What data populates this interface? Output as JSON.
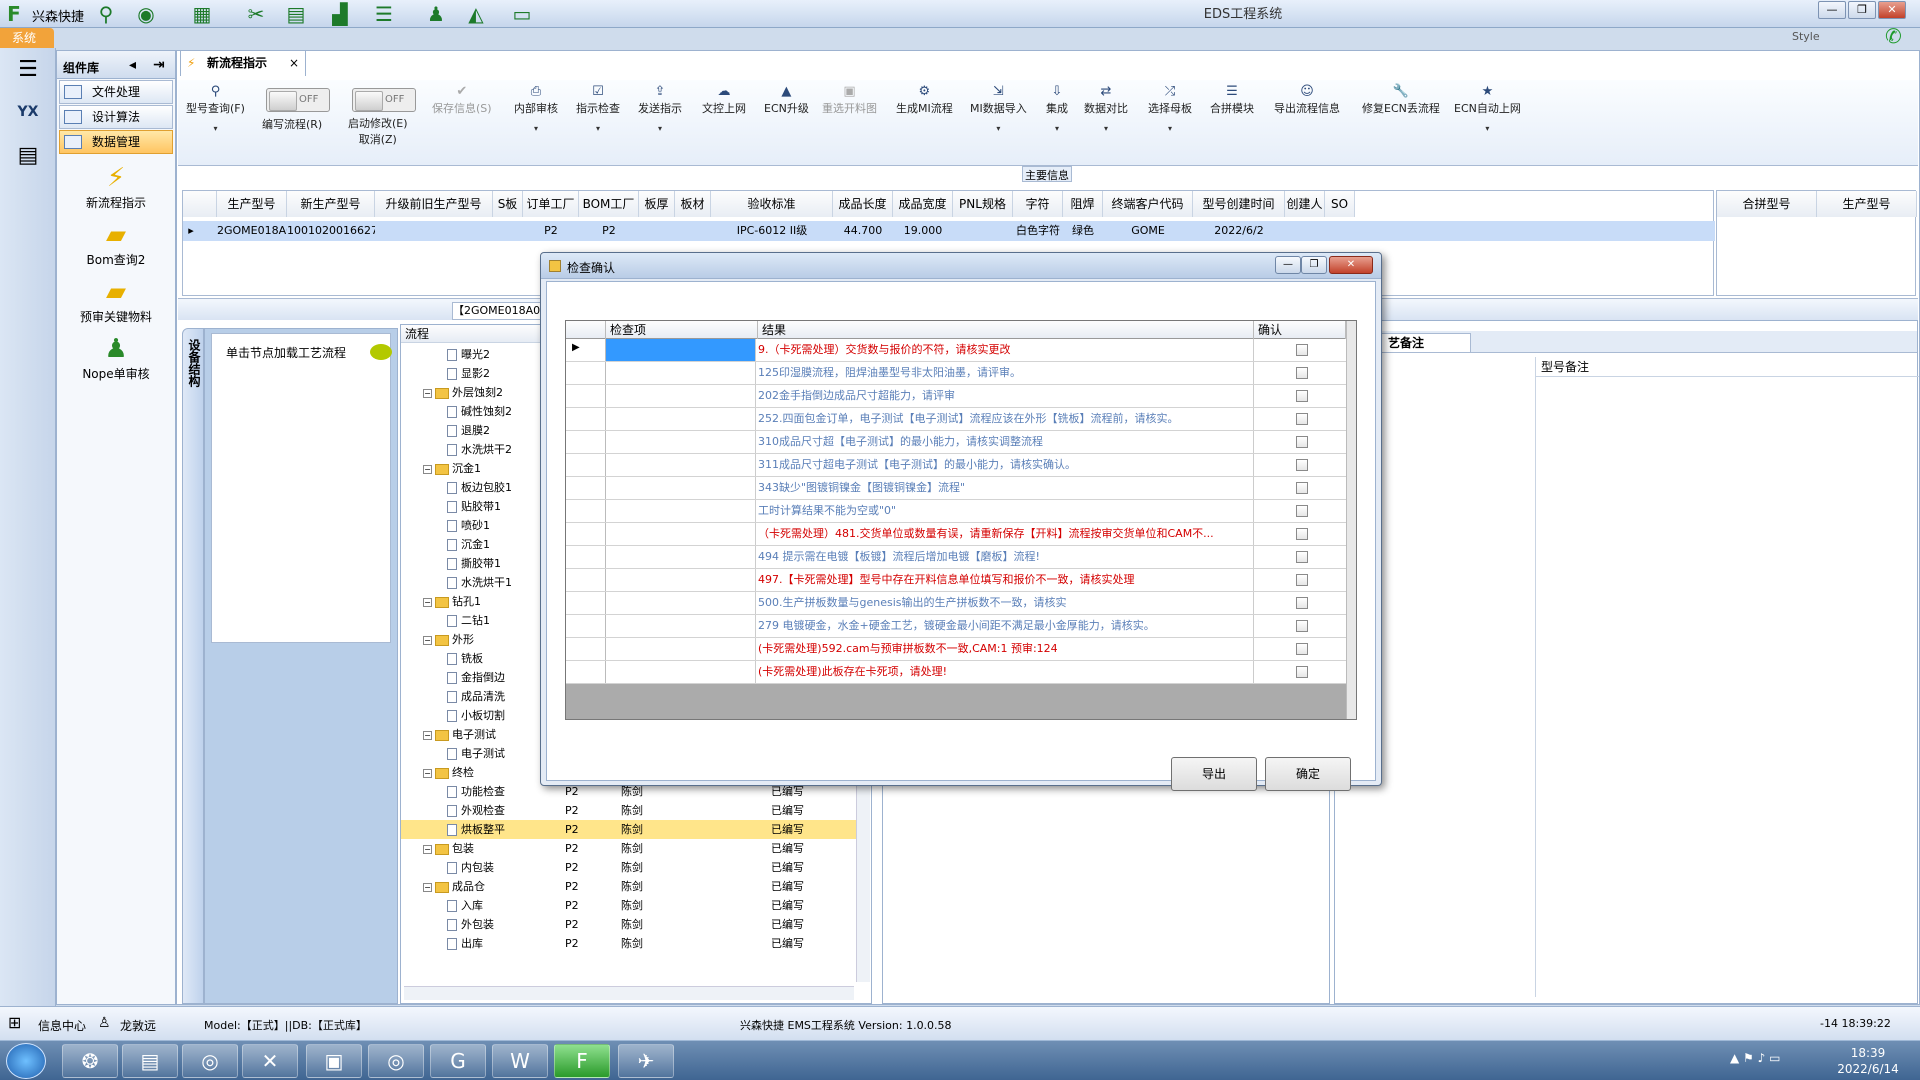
{
  "window": {
    "app_brand": "兴森快捷",
    "title": "EDS工程系统",
    "style_label": "Style",
    "system_tab": "系统"
  },
  "component_panel": {
    "title": "组件库",
    "items": [
      {
        "label": "文件处理",
        "selected": false
      },
      {
        "label": "设计算法",
        "selected": false
      },
      {
        "label": "数据管理",
        "selected": true
      }
    ],
    "big_items": [
      {
        "label": "新流程指示",
        "icon": "lightning-icon"
      },
      {
        "label": "Bom查询2",
        "icon": "folder-icon"
      },
      {
        "label": "预审关键物料",
        "icon": "folder-icon"
      },
      {
        "label": "Nope单审核",
        "icon": "user-icon"
      }
    ]
  },
  "doc_tab": {
    "label": "新流程指示",
    "close": "×"
  },
  "ribbon": {
    "buttons": [
      {
        "label": "型号查询(F)",
        "icon": "search-icon",
        "disabled": false,
        "dropdown": true
      },
      {
        "label": "编写流程(R)",
        "icon": "toggle-icon",
        "disabled": false,
        "dropdown": false
      },
      {
        "label": "启动修改(E)",
        "sub": "取消(Z)",
        "icon": "toggle-icon",
        "disabled": false,
        "dropdown": false
      },
      {
        "label": "保存信息(S)",
        "icon": "check-icon",
        "disabled": true,
        "dropdown": false
      },
      {
        "label": "内部审核",
        "icon": "print-icon",
        "disabled": false,
        "dropdown": true
      },
      {
        "label": "指示检查",
        "icon": "checklist-icon",
        "disabled": false,
        "dropdown": true
      },
      {
        "label": "发送指示",
        "icon": "upload-icon",
        "disabled": false,
        "dropdown": true
      },
      {
        "label": "文控上网",
        "icon": "cloud-icon",
        "disabled": false,
        "dropdown": false
      },
      {
        "label": "ECN升级",
        "icon": "upgrade-icon",
        "disabled": false,
        "dropdown": false
      },
      {
        "label": "重选开料图",
        "icon": "image-icon",
        "disabled": true,
        "dropdown": false
      },
      {
        "label": "生成MI流程",
        "icon": "gears-icon",
        "disabled": false,
        "dropdown": false
      },
      {
        "label": "MI数据导入",
        "icon": "import-icon",
        "disabled": false,
        "dropdown": true
      },
      {
        "label": "集成",
        "icon": "download-icon",
        "disabled": false,
        "dropdown": true
      },
      {
        "label": "数据对比",
        "icon": "compare-icon",
        "disabled": false,
        "dropdown": true
      },
      {
        "label": "选择母板",
        "icon": "shuffle-icon",
        "disabled": false,
        "dropdown": true
      },
      {
        "label": "合拼模块",
        "icon": "list-icon",
        "disabled": false,
        "dropdown": false
      },
      {
        "label": "导出流程信息",
        "icon": "smile-icon",
        "disabled": false,
        "dropdown": false
      },
      {
        "label": "修复ECN丢流程",
        "icon": "wrench-icon",
        "disabled": false,
        "dropdown": false
      },
      {
        "label": "ECN自动上网",
        "icon": "star-icon",
        "disabled": false,
        "dropdown": true
      }
    ],
    "toggle_off": "OFF"
  },
  "main_info": {
    "section_label": "主要信息",
    "columns": [
      "生产型号",
      "新生产型号",
      "升级前旧生产型号",
      "S板",
      "订单工厂",
      "BOM工厂",
      "板厚",
      "板材",
      "验收标准",
      "成品长度",
      "成品宽度",
      "PNL规格",
      "字符",
      "阻焊",
      "终端客户代码",
      "型号创建时间",
      "创建人",
      "SO"
    ],
    "row": [
      "2GOME018A0",
      "10010200166276",
      "",
      "",
      "P2",
      "P2",
      "",
      "",
      "IPC-6012 II级",
      "44.700",
      "19.000",
      "",
      "白色字符",
      "绿色",
      "GOME",
      "2022/6/2",
      "",
      ""
    ],
    "right_columns": [
      "合拼型号",
      "生产型号"
    ]
  },
  "lower": {
    "model_tab": "【2GOME018A0】",
    "side_tab": "设备结构",
    "left_card_text": "单击节点加载工艺流程",
    "tree_header": "流程",
    "right_tab": "艺备注",
    "right_col": "型号备注",
    "tree": [
      {
        "level": 2,
        "type": "doc",
        "label": "曝光2"
      },
      {
        "level": 2,
        "type": "doc",
        "label": "显影2"
      },
      {
        "level": 1,
        "type": "folder",
        "label": "外层蚀刻2"
      },
      {
        "level": 2,
        "type": "doc",
        "label": "碱性蚀刻2"
      },
      {
        "level": 2,
        "type": "doc",
        "label": "退膜2"
      },
      {
        "level": 2,
        "type": "doc",
        "label": "水洗烘干2"
      },
      {
        "level": 1,
        "type": "folder",
        "label": "沉金1"
      },
      {
        "level": 2,
        "type": "doc",
        "label": "板边包胶1"
      },
      {
        "level": 2,
        "type": "doc",
        "label": "贴胶带1"
      },
      {
        "level": 2,
        "type": "doc",
        "label": "喷砂1"
      },
      {
        "level": 2,
        "type": "doc",
        "label": "沉金1"
      },
      {
        "level": 2,
        "type": "doc",
        "label": "撕胶带1"
      },
      {
        "level": 2,
        "type": "doc",
        "label": "水洗烘干1"
      },
      {
        "level": 1,
        "type": "folder",
        "label": "钻孔1"
      },
      {
        "level": 2,
        "type": "doc",
        "label": "二钻1"
      },
      {
        "level": 1,
        "type": "folder",
        "label": "外形"
      },
      {
        "level": 2,
        "type": "doc",
        "label": "铣板"
      },
      {
        "level": 2,
        "type": "doc",
        "label": "金指倒边"
      },
      {
        "level": 2,
        "type": "doc",
        "label": "成品清洗"
      },
      {
        "level": 2,
        "type": "doc",
        "label": "小板切割"
      },
      {
        "level": 1,
        "type": "folder",
        "label": "电子测试"
      },
      {
        "level": 2,
        "type": "doc",
        "label": "电子测试"
      },
      {
        "level": 1,
        "type": "folder",
        "label": "终检"
      },
      {
        "level": 2,
        "type": "doc",
        "label": "功能检查",
        "f": "P2",
        "p": "陈剑",
        "s": "已编写"
      },
      {
        "level": 2,
        "type": "doc",
        "label": "外观检查",
        "f": "P2",
        "p": "陈剑",
        "s": "已编写"
      },
      {
        "level": 2,
        "type": "doc",
        "label": "烘板整平",
        "f": "P2",
        "p": "陈剑",
        "s": "已编写",
        "hl": true
      },
      {
        "level": 1,
        "type": "folder",
        "label": "包装",
        "f": "P2",
        "p": "陈剑",
        "s": "已编写"
      },
      {
        "level": 2,
        "type": "doc",
        "label": "内包装",
        "f": "P2",
        "p": "陈剑",
        "s": "已编写"
      },
      {
        "level": 1,
        "type": "folder",
        "label": "成品仓",
        "f": "P2",
        "p": "陈剑",
        "s": "已编写"
      },
      {
        "level": 2,
        "type": "doc",
        "label": "入库",
        "f": "P2",
        "p": "陈剑",
        "s": "已编写"
      },
      {
        "level": 2,
        "type": "doc",
        "label": "外包装",
        "f": "P2",
        "p": "陈剑",
        "s": "已编写"
      },
      {
        "level": 2,
        "type": "doc",
        "label": "出库",
        "f": "P2",
        "p": "陈剑",
        "s": "已编写"
      }
    ]
  },
  "dialog": {
    "title": "检查确认",
    "columns": [
      "检查项",
      "结果",
      "确认"
    ],
    "rows": [
      {
        "text": "9.（卡死需处理）交货数与报价的不符，请核实更改",
        "color": "red"
      },
      {
        "text": "125印湿膜流程，阻焊油墨型号非太阳油墨，请评审。",
        "color": "blue"
      },
      {
        "text": "202金手指倒边成品尺寸超能力，请评审",
        "color": "blue"
      },
      {
        "text": "252.四面包金订单，电子测试【电子测试】流程应该在外形【铣板】流程前，请核实。",
        "color": "blue"
      },
      {
        "text": "310成品尺寸超【电子测试】的最小能力，请核实调整流程",
        "color": "blue"
      },
      {
        "text": "311成品尺寸超电子测试【电子测试】的最小能力，请核实确认。",
        "color": "blue"
      },
      {
        "text": "343缺少\"图镀铜镍金【图镀铜镍金】流程\"",
        "color": "blue"
      },
      {
        "text": "工时计算结果不能为空或\"0\"",
        "color": "blue"
      },
      {
        "text": "（卡死需处理）481.交货单位或数量有误，请重新保存【开料】流程按审交货单位和CAM不...",
        "color": "red"
      },
      {
        "text": "494 提示需在电镀【板镀】流程后增加电镀【磨板】流程!",
        "color": "blue"
      },
      {
        "text": "497.【卡死需处理】型号中存在开料信息单位填写和报价不一致，请核实处理",
        "color": "red"
      },
      {
        "text": "500.生产拼板数量与genesis输出的生产拼板数不一致，请核实",
        "color": "blue"
      },
      {
        "text": "279 电镀硬金，水金+硬金工艺，镀硬金最小间距不满足最小金厚能力，请核实。",
        "color": "blue"
      },
      {
        "text": "(卡死需处理)592.cam与预审拼板数不一致,CAM:1 预审:124",
        "color": "red"
      },
      {
        "text": "(卡死需处理)此板存在卡死项，请处理!",
        "color": "red"
      }
    ],
    "export_label": "导出",
    "ok_label": "确定"
  },
  "status": {
    "info_center": "信息中心",
    "user": "龙敦远",
    "model_db": "Model:【正式】||DB:【正式库】",
    "version": "兴森快捷 EMS工程系统 Version: 1.0.0.58",
    "datetime_partial": "-14 18:39:22"
  },
  "taskbar": {
    "time": "18:39",
    "date": "2022/6/14"
  }
}
